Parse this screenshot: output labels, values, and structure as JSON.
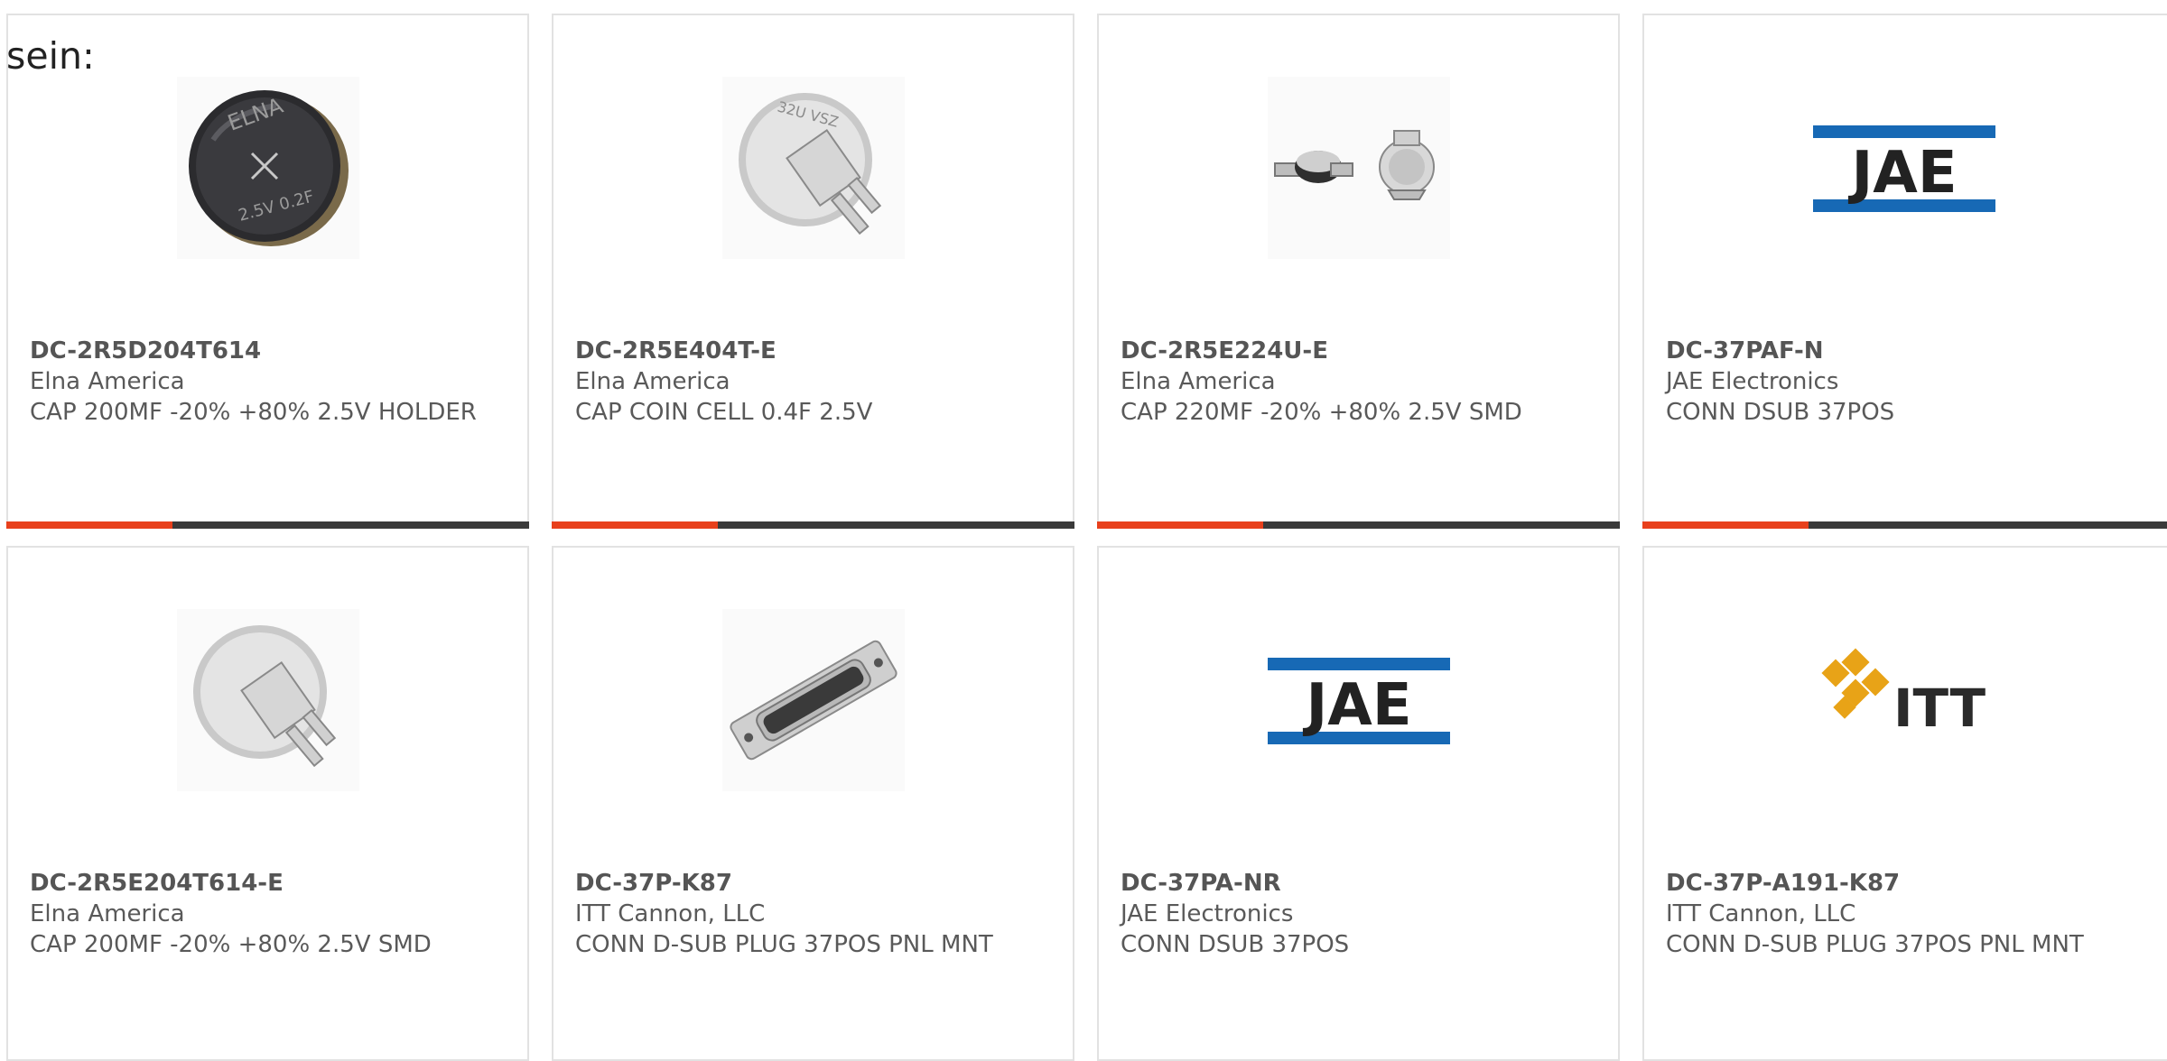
{
  "intro_text": "sein:",
  "colors": {
    "accent": "#e8401c",
    "bar": "#3a3a3a",
    "jae_blue": "#1769b5",
    "itt_gold": "#e8a317"
  },
  "products": [
    {
      "part": "DC-2R5D204T614",
      "manufacturer": "Elna America",
      "description": "CAP 200MF -20% +80% 2.5V HOLDER",
      "image": "black-coin-cell-image"
    },
    {
      "part": "DC-2R5E404T-E",
      "manufacturer": "Elna America",
      "description": "CAP COIN CELL 0.4F 2.5V",
      "image": "silver-coin-cell-image"
    },
    {
      "part": "DC-2R5E224U-E",
      "manufacturer": "Elna America",
      "description": "CAP 220MF -20% +80% 2.5V SMD",
      "image": "smd-coin-cell-image"
    },
    {
      "part": "DC-37PAF-N",
      "manufacturer": "JAE Electronics",
      "description": "CONN DSUB 37POS",
      "image": "jae-logo",
      "logo_text": "JAE"
    },
    {
      "part": "DC-2R5E204T614-E",
      "manufacturer": "Elna America",
      "description": "CAP 200MF -20% +80% 2.5V SMD",
      "image": "silver-coin-cell-image"
    },
    {
      "part": "DC-37P-K87",
      "manufacturer": "ITT Cannon, LLC",
      "description": "CONN D-SUB PLUG 37POS PNL MNT",
      "image": "dsub-connector-image"
    },
    {
      "part": "DC-37PA-NR",
      "manufacturer": "JAE Electronics",
      "description": "CONN DSUB 37POS",
      "image": "jae-logo",
      "logo_text": "JAE"
    },
    {
      "part": "DC-37P-A191-K87",
      "manufacturer": "ITT Cannon, LLC",
      "description": "CONN D-SUB PLUG 37POS PNL MNT",
      "image": "itt-logo",
      "logo_text": "ITT"
    }
  ]
}
